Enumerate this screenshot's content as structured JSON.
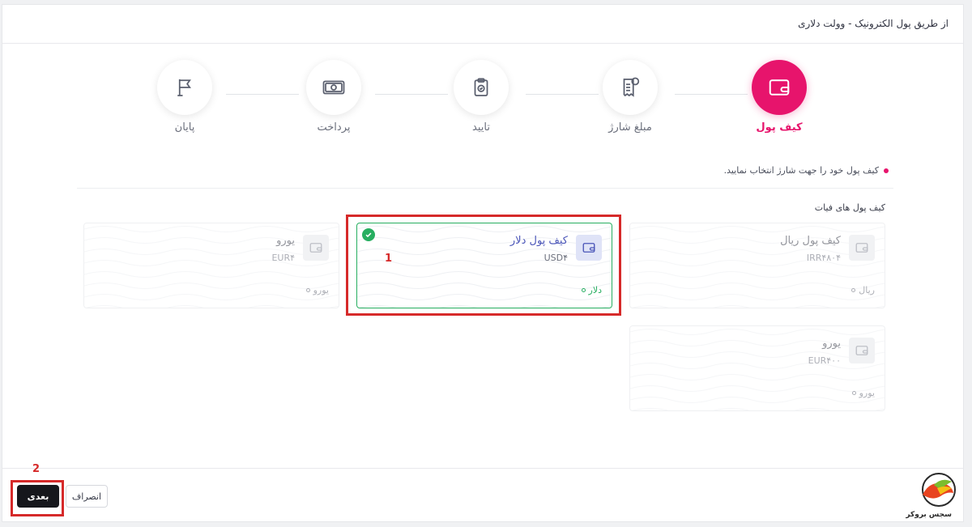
{
  "header": {
    "title": "از طریق پول الکترونیک - وولت دلاری"
  },
  "stepper": {
    "steps": [
      {
        "label": "کیف پول",
        "icon": "wallet-icon",
        "active": true
      },
      {
        "label": "مبلغ شارژ",
        "icon": "invoice-icon",
        "active": false
      },
      {
        "label": "تایید",
        "icon": "clipboard-check-icon",
        "active": false
      },
      {
        "label": "پرداخت",
        "icon": "banknote-icon",
        "active": false
      },
      {
        "label": "پایان",
        "icon": "flag-icon",
        "active": false
      }
    ]
  },
  "hint": "کیف پول خود را جهت شارژ انتخاب نمایید.",
  "section_title": "کیف پول های فیات",
  "wallets": [
    {
      "name": "کیف پول ریال",
      "number": "IRR۴۸۰۴",
      "currency": "ریال",
      "selected": false
    },
    {
      "name": "کیف پول دلار",
      "number": "USD۴",
      "currency": "دلار",
      "selected": true
    },
    {
      "name": "یورو",
      "number": "EUR۴",
      "currency": "یورو",
      "selected": false
    },
    {
      "name": "یورو",
      "number": "EUR۴۰۰",
      "currency": "یورو",
      "selected": false
    }
  ],
  "annotations": {
    "one": "1",
    "two": "2"
  },
  "footer": {
    "next_label": "بعدی",
    "cancel_label": "انصراف",
    "logo_text": "سجس بروکر"
  },
  "colors": {
    "accent": "#e7146c",
    "selected": "#27ae60",
    "annotation": "#d62a2a",
    "dark_button": "#16171c"
  }
}
